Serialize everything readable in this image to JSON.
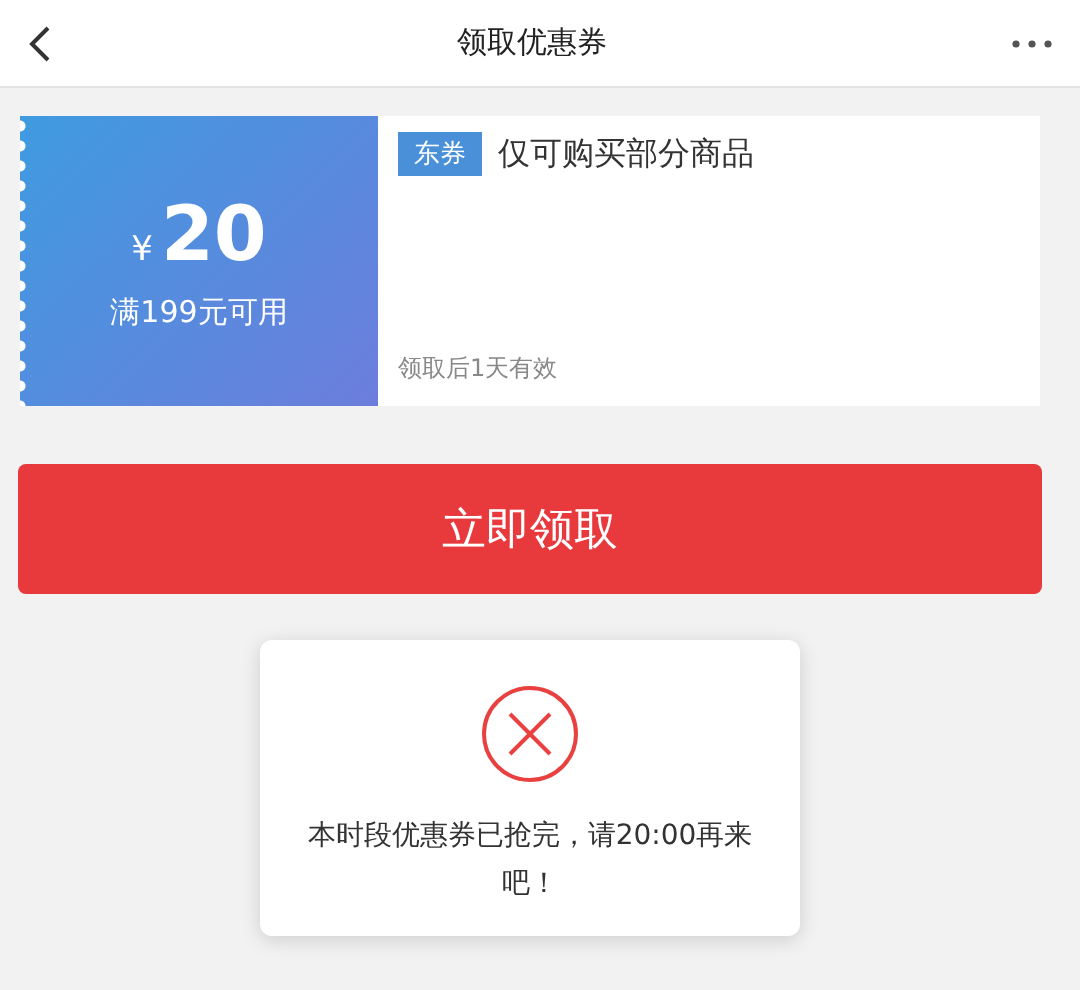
{
  "header": {
    "title": "领取优惠券"
  },
  "coupon": {
    "currency": "¥",
    "amount": "20",
    "condition": "满199元可用",
    "tag": "东券",
    "description": "仅可购买部分商品",
    "validity": "领取后1天有效"
  },
  "claim_button": "立即领取",
  "toast": {
    "message": "本时段优惠券已抢完，请20:00再来吧！"
  }
}
